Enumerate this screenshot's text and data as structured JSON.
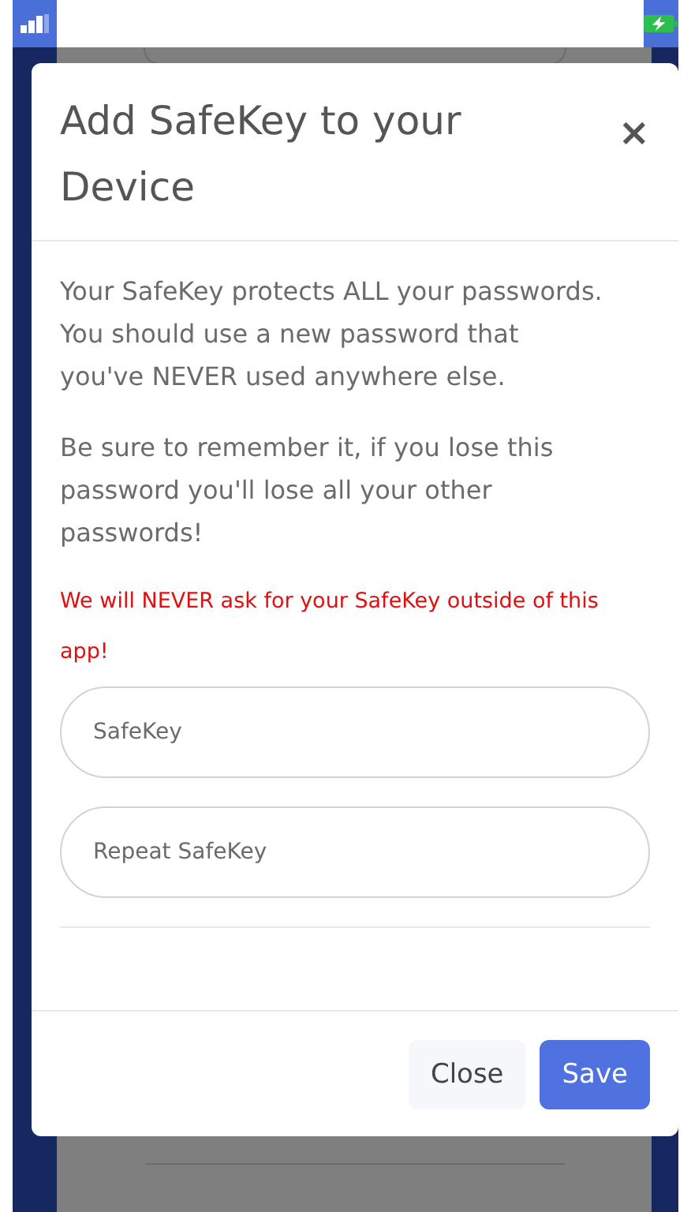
{
  "modal": {
    "title": "Add SafeKey to your Device",
    "close_symbol": "×",
    "paragraphs": [
      "Your SafeKey protects ALL your passwords.  You should use a new password that you've NEVER used anywhere else.",
      "Be sure to remember it, if you lose this password you'll lose all your other passwords!"
    ],
    "warning": "We will NEVER ask for your SafeKey outside of this app!",
    "fields": [
      {
        "placeholder": "SafeKey"
      },
      {
        "placeholder": "Repeat SafeKey"
      }
    ],
    "buttons": [
      {
        "label": "Close",
        "kind": "secondary"
      },
      {
        "label": "Save",
        "kind": "primary"
      }
    ]
  }
}
